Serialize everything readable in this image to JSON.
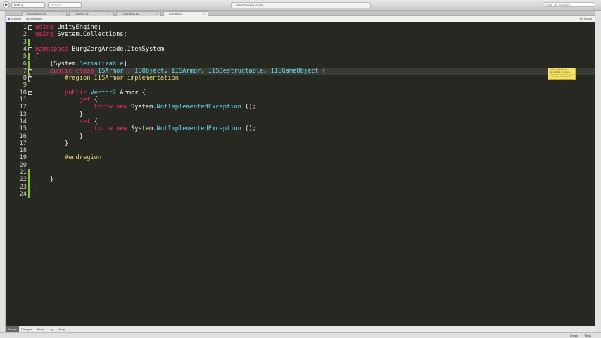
{
  "toolbar": {
    "config": "Debug",
    "platform": "Default",
    "status": "MonoDevelop-Unity",
    "search_placeholder": "Press '⌘.' to search"
  },
  "tabs": [
    {
      "label": "IIISWeapon.cs"
    },
    {
      "label": "ISArmor.cs"
    },
    {
      "label": "ISWeapon.cs"
    },
    {
      "label": "ISArmor.cs"
    }
  ],
  "breadcrumb": {
    "file": "ISArmor",
    "selection": "No selection",
    "region": "No region"
  },
  "tooltip": {
    "title": "Implement Interface",
    "body": "Use Up/Down to move to another location. Press Enter to select the location. Press Esc to cancel this operation."
  },
  "code": [
    {
      "n": "1",
      "t": [
        [
          "kw",
          "using"
        ],
        [
          "pl",
          " UnityEngine;"
        ]
      ]
    },
    {
      "n": "2",
      "t": [
        [
          "kw",
          "using"
        ],
        [
          "pl",
          " System.Collections;"
        ]
      ]
    },
    {
      "n": "3",
      "t": []
    },
    {
      "n": "4",
      "t": [
        [
          "kw",
          "namespace"
        ],
        [
          "pl",
          " BurgZergArcade.ItemSystem"
        ]
      ]
    },
    {
      "n": "5",
      "t": [
        [
          "pl",
          "{"
        ]
      ]
    },
    {
      "n": "6",
      "t": [
        [
          "pl",
          "    [System."
        ],
        [
          "ty",
          "Serializable"
        ],
        [
          "pl",
          "]"
        ]
      ]
    },
    {
      "n": "7",
      "t": [
        [
          "kw",
          "    public class"
        ],
        [
          "ty",
          " ISArmor"
        ],
        [
          "pl",
          " : "
        ],
        [
          "ty",
          "ISObject"
        ],
        [
          "pl",
          ", "
        ],
        [
          "ty",
          "IISArmor"
        ],
        [
          "pl",
          ", "
        ],
        [
          "ty",
          "IISDestructable"
        ],
        [
          "pl",
          ", "
        ],
        [
          "ty",
          "IISGameObject"
        ],
        [
          "pl",
          " {"
        ]
      ]
    },
    {
      "n": "8",
      "t": [
        [
          "rg",
          "        #region IISArmor implementation"
        ]
      ]
    },
    {
      "n": "9",
      "t": []
    },
    {
      "n": "10",
      "t": [
        [
          "kw",
          "        public"
        ],
        [
          "ty",
          " Vector2"
        ],
        [
          "pl",
          " Armor {"
        ]
      ]
    },
    {
      "n": "11",
      "t": [
        [
          "kw",
          "            get"
        ],
        [
          "pl",
          " {"
        ]
      ]
    },
    {
      "n": "12",
      "t": [
        [
          "kw",
          "                throw new"
        ],
        [
          "pl",
          " System."
        ],
        [
          "ty",
          "NotImplementedException"
        ],
        [
          "pl",
          " ();"
        ]
      ]
    },
    {
      "n": "13",
      "t": [
        [
          "pl",
          "            }"
        ]
      ]
    },
    {
      "n": "14",
      "t": [
        [
          "kw",
          "            set"
        ],
        [
          "pl",
          " {"
        ]
      ]
    },
    {
      "n": "15",
      "t": [
        [
          "kw",
          "                throw new"
        ],
        [
          "pl",
          " System."
        ],
        [
          "ty",
          "NotImplementedException"
        ],
        [
          "pl",
          " ();"
        ]
      ]
    },
    {
      "n": "16",
      "t": [
        [
          "pl",
          "            }"
        ]
      ]
    },
    {
      "n": "17",
      "t": [
        [
          "pl",
          "        }"
        ]
      ]
    },
    {
      "n": "18",
      "t": []
    },
    {
      "n": "19",
      "t": [
        [
          "rg",
          "        #endregion"
        ]
      ]
    },
    {
      "n": "20",
      "t": []
    },
    {
      "n": "21",
      "t": []
    },
    {
      "n": "22",
      "t": [
        [
          "pl",
          "    }"
        ]
      ]
    },
    {
      "n": "23",
      "t": [
        [
          "pl",
          "}"
        ]
      ]
    },
    {
      "n": "24",
      "t": []
    }
  ],
  "bottom_tabs": [
    "Source",
    "Changes",
    "Blame",
    "Log",
    "Merge"
  ],
  "status": {
    "errors": "Errors",
    "tasks": "Tasks"
  }
}
